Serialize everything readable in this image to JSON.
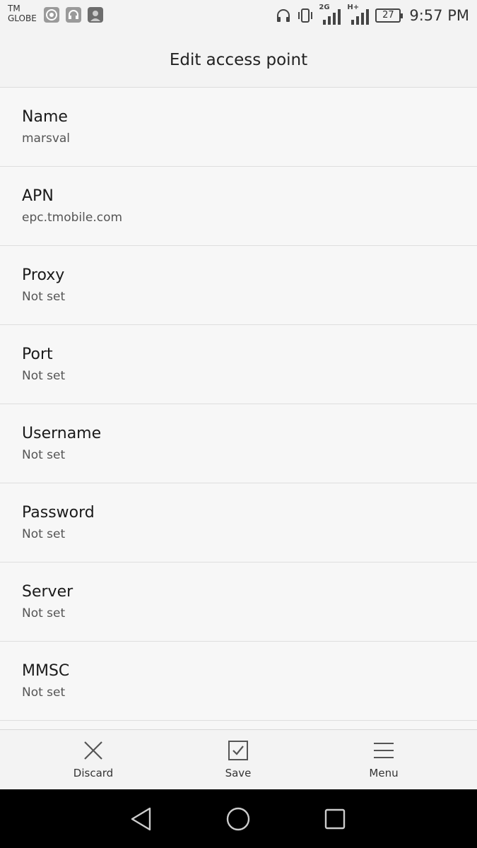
{
  "status_bar": {
    "carrier_line1": "TM",
    "carrier_line2": "GLOBE",
    "network_2g": "2G",
    "network_hplus": "H+",
    "battery_level": "27",
    "time": "9:57 PM"
  },
  "header": {
    "title": "Edit access point"
  },
  "fields": [
    {
      "label": "Name",
      "value": "marsval"
    },
    {
      "label": "APN",
      "value": "epc.tmobile.com"
    },
    {
      "label": "Proxy",
      "value": "Not set"
    },
    {
      "label": "Port",
      "value": "Not set"
    },
    {
      "label": "Username",
      "value": "Not set"
    },
    {
      "label": "Password",
      "value": "Not set"
    },
    {
      "label": "Server",
      "value": "Not set"
    },
    {
      "label": "MMSC",
      "value": "Not set"
    }
  ],
  "actions": {
    "discard_label": "Discard",
    "save_label": "Save",
    "menu_label": "Menu"
  },
  "icons": {
    "discard": "close-icon",
    "save": "checkbox-check-icon",
    "menu": "hamburger-menu-icon",
    "nav_back": "triangle-back-icon",
    "nav_home": "circle-home-icon",
    "nav_recents": "square-recents-icon"
  }
}
